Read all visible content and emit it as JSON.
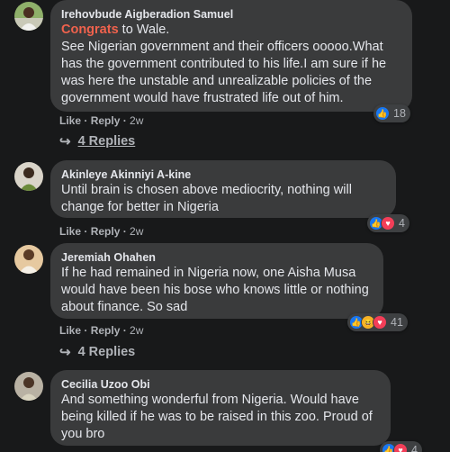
{
  "comments": [
    {
      "author": "Irehovbude Aigberadion Samuel",
      "mention": "Congrats",
      "text_after_mention": " to Wale.",
      "lines": [
        "See Nigerian government and their officers ooooo.What",
        "has the government contributed to his life.I am sure if he",
        "was here the unstable and unrealizable policies of the",
        "government would have frustrated life out of him."
      ],
      "like": "Like",
      "reply": "Reply",
      "time": "2w",
      "reaction_count": "18",
      "reactions": [
        "like"
      ],
      "replies_label": "4 Replies"
    },
    {
      "author": "Akinleye Akinniyi A-kine",
      "lines": [
        "Until brain is chosen above mediocrity, nothing will",
        "change for better in Nigeria"
      ],
      "like": "Like",
      "reply": "Reply",
      "time": "2w",
      "reaction_count": "4",
      "reactions": [
        "like",
        "love"
      ]
    },
    {
      "author": "Jeremiah Ohahen",
      "lines": [
        "If he had remained in Nigeria now, one Aisha Musa",
        "would have been his bose who knows little or nothing",
        "about finance. So sad"
      ],
      "like": "Like",
      "reply": "Reply",
      "time": "2w",
      "reaction_count": "41",
      "reactions": [
        "like",
        "haha",
        "love"
      ],
      "replies_label": "4 Replies"
    },
    {
      "author": "Cecilia Uzoo Obi",
      "lines": [
        "And something wonderful from Nigeria. Would have",
        "being killed if he was to be raised in this zoo. Proud of",
        "you bro"
      ],
      "reaction_count": "4",
      "reactions": [
        "like",
        "love"
      ]
    }
  ],
  "colors": {
    "background": "#18191a",
    "bubble": "#3a3b3c",
    "mention": "#f0624d",
    "like_blue": "#1877f2",
    "love_red": "#f33e58"
  }
}
